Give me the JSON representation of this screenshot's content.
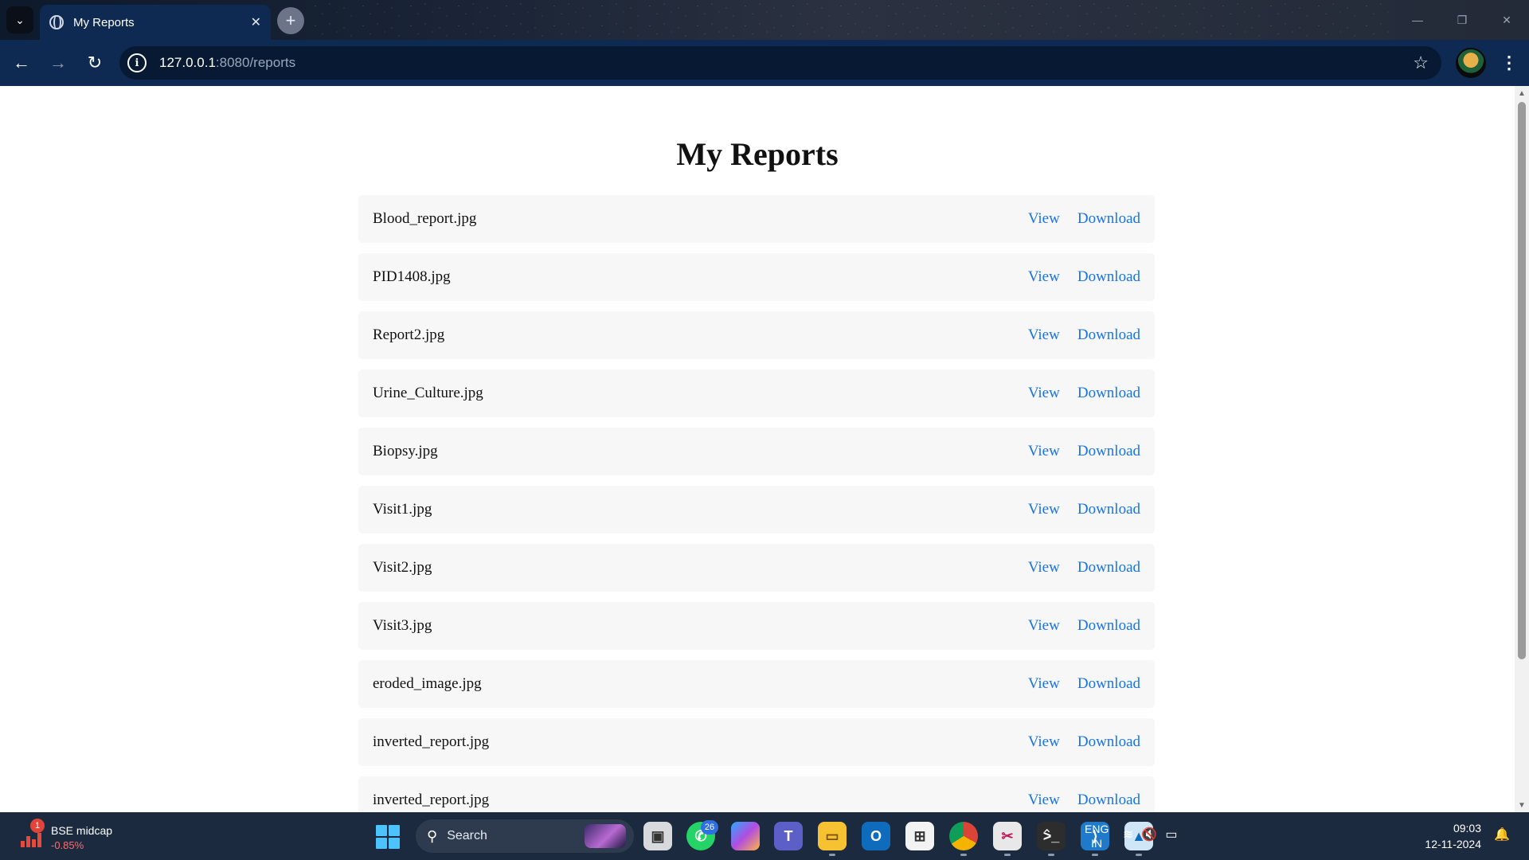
{
  "browser": {
    "tab_title": "My Reports",
    "tab_close": "✕",
    "new_tab": "+",
    "url_host": "127.0.0.1",
    "url_path": ":8080/reports",
    "window_controls": [
      "—",
      "❐",
      "✕"
    ]
  },
  "page": {
    "title": "My Reports",
    "view_label": "View",
    "download_label": "Download",
    "reports": [
      {
        "name": "Blood_report.jpg"
      },
      {
        "name": "PID1408.jpg"
      },
      {
        "name": "Report2.jpg"
      },
      {
        "name": "Urine_Culture.jpg"
      },
      {
        "name": "Biopsy.jpg"
      },
      {
        "name": "Visit1.jpg"
      },
      {
        "name": "Visit2.jpg"
      },
      {
        "name": "Visit3.jpg"
      },
      {
        "name": "eroded_image.jpg"
      },
      {
        "name": "inverted_report.jpg"
      },
      {
        "name": "inverted_report.jpg"
      }
    ]
  },
  "taskbar": {
    "widget": {
      "badge": "1",
      "title": "BSE midcap",
      "change": "-0.85%"
    },
    "search_label": "Search",
    "whatsapp_badge": "26",
    "lang_line1": "ENG",
    "lang_line2": "IN",
    "time": "09:03",
    "date": "12-11-2024"
  },
  "colors": {
    "link": "#1a73e8",
    "row_bg": "#f7f7f7",
    "chrome_bg": "#0e2a52",
    "taskbar_bg": "#1b2a3e"
  }
}
